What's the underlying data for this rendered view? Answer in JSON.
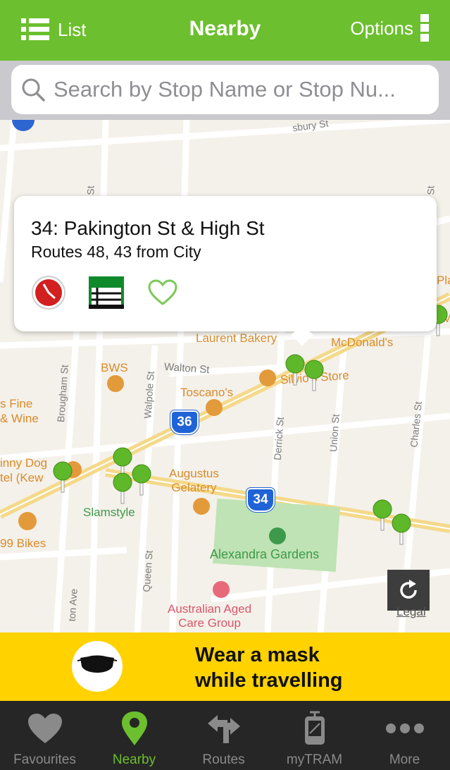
{
  "header": {
    "list_label": "List",
    "title": "Nearby",
    "options_label": "Options"
  },
  "search": {
    "placeholder": "Search by Stop Name or Stop Nu..."
  },
  "callout": {
    "stop_title": "34: Pakington St & High St",
    "routes": "Routes 48, 43 from City"
  },
  "map": {
    "labels": {
      "laurent": "Laurent Bakery",
      "mcdonalds": "McDonald's",
      "bws": "BWS",
      "walton": "Walton St",
      "silvios": "Silvio's Store",
      "toscanos": "Toscano's",
      "fine_wine": "s Fine\n& Wine",
      "brougham": "Brougham St",
      "walpole": "Walpole St",
      "derrick": "Derrick St",
      "union": "Union St",
      "charles": "Charles St",
      "queen": "Queen St",
      "ton_ave": "ton Ave",
      "kew": "inny Dog\ntel (Kew",
      "augustus": "Augustus\nGelatery",
      "slamstyle": "Slamstyle",
      "bikes": "99 Bikes",
      "alexandra": "Alexandra Gardens",
      "aged_care": "Australian Aged\nCare Group",
      "sbury": "sbury St",
      "top_st": "St",
      "right_st": "St",
      "pla": "Pla",
      "m": "M"
    },
    "shields": {
      "route_a": "36",
      "route_b": "34"
    },
    "legal": "Legal"
  },
  "banner": {
    "line1": "Wear a mask",
    "line2": "while travelling"
  },
  "tabs": [
    {
      "label": "Favourites",
      "icon": "heart-icon"
    },
    {
      "label": "Nearby",
      "icon": "location-pin-icon"
    },
    {
      "label": "Routes",
      "icon": "routes-icon"
    },
    {
      "label": "myTRAM",
      "icon": "tram-icon"
    },
    {
      "label": "More",
      "icon": "more-icon"
    }
  ],
  "colors": {
    "brand_green": "#6cbf2e",
    "banner_yellow": "#ffd200",
    "shield_blue": "#1f63d6",
    "tabbar": "#262626"
  }
}
